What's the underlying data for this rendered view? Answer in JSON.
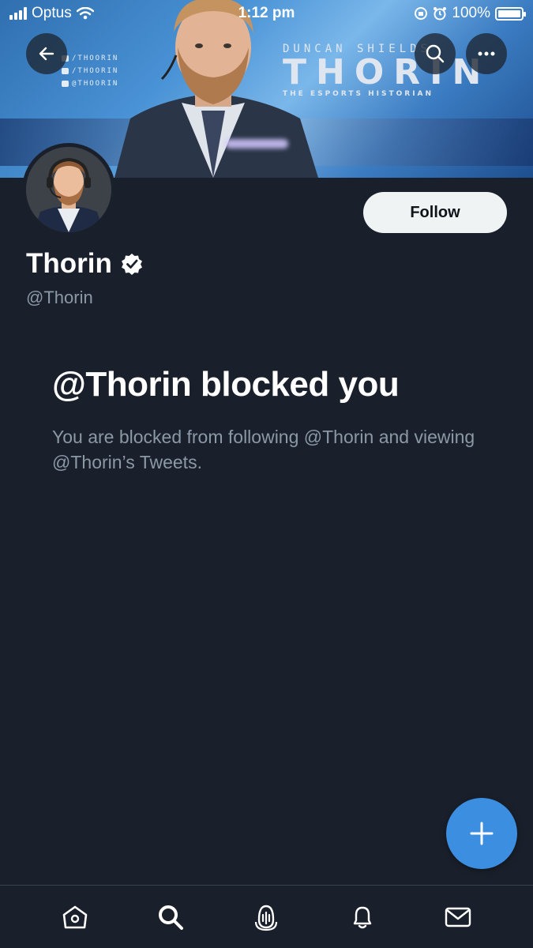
{
  "status_bar": {
    "carrier": "Optus",
    "time": "1:12 pm",
    "battery": "100%"
  },
  "banner": {
    "socials": [
      "/THOORIN",
      "/THOORIN",
      "@THOORIN"
    ],
    "brand_top": "DUNCAN SHIELDS",
    "brand_name": "THORIN",
    "brand_sub": "THE ESPORTS HISTORIAN"
  },
  "profile": {
    "name": "Thorin",
    "handle": "@Thorin",
    "verified": true,
    "follow_label": "Follow"
  },
  "blocked": {
    "title": "@Thorin blocked you",
    "message": "You are blocked from following @Thorin and viewing @Thorin’s Tweets."
  },
  "colors": {
    "background": "#1a202b",
    "accent": "#3b8ee0",
    "secondary_text": "#8b98a5",
    "follow_bg": "#eff3f4"
  },
  "tabs": [
    {
      "name": "home",
      "icon": "home-icon"
    },
    {
      "name": "search",
      "icon": "search-icon"
    },
    {
      "name": "spaces",
      "icon": "spaces-icon"
    },
    {
      "name": "notifications",
      "icon": "bell-icon"
    },
    {
      "name": "messages",
      "icon": "mail-icon"
    }
  ]
}
